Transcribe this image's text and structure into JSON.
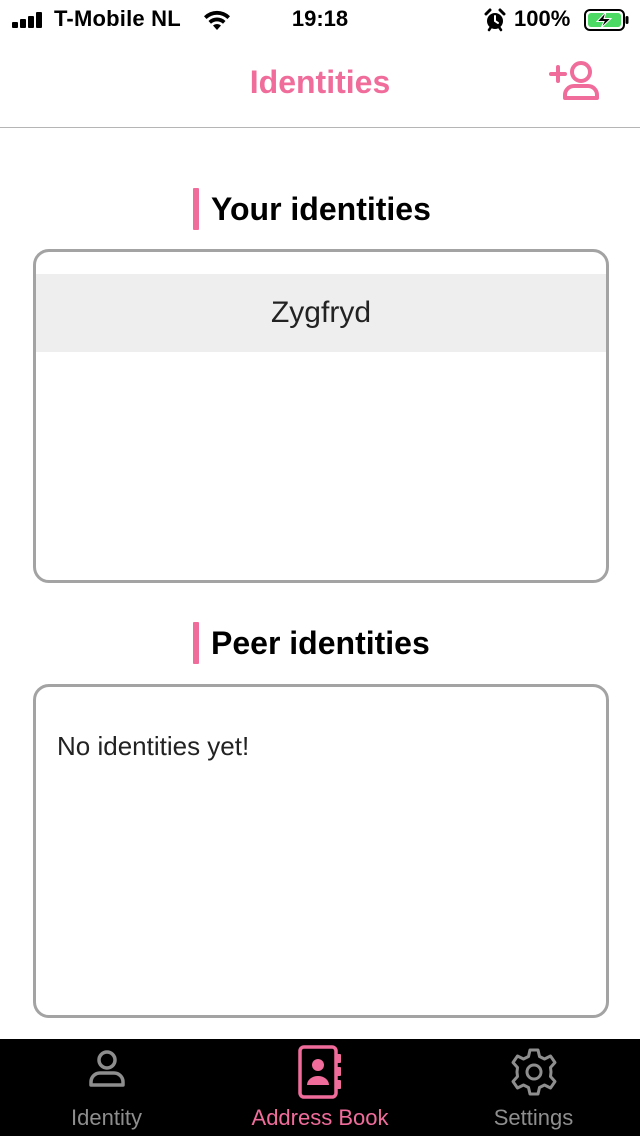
{
  "status_bar": {
    "carrier": "T-Mobile NL",
    "time": "19:18",
    "battery_percent": "100%",
    "icons": [
      "signal-icon",
      "wifi-icon",
      "alarm-icon",
      "battery-charging-icon"
    ]
  },
  "nav": {
    "title": "Identities",
    "action_icon": "add-user-icon"
  },
  "sections": {
    "your_identities": {
      "title": "Your identities",
      "items": [
        {
          "name": "Zygfryd"
        }
      ]
    },
    "peer_identities": {
      "title": "Peer identities",
      "empty_message": "No identities yet!"
    }
  },
  "tabs": [
    {
      "label": "Identity",
      "icon": "person-icon",
      "active": false
    },
    {
      "label": "Address Book",
      "icon": "address-book-icon",
      "active": true
    },
    {
      "label": "Settings",
      "icon": "gear-icon",
      "active": false
    }
  ],
  "colors": {
    "accent": "#f06c9b",
    "tab_inactive": "#8e8e8e",
    "tab_bar_bg": "#000000",
    "card_border": "#a3a3a3",
    "selected_row": "#eeeeee"
  }
}
